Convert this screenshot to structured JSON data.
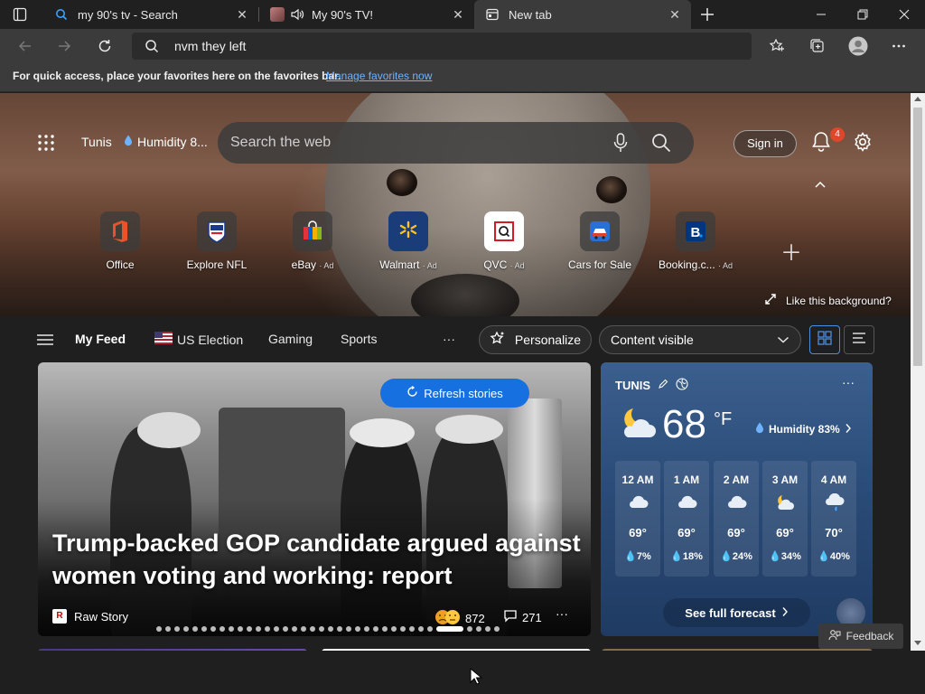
{
  "tabs": [
    {
      "title": "my 90's tv - Search",
      "icon": "search-icon"
    },
    {
      "title": "My 90's TV!",
      "icon": "audio-playing-icon"
    },
    {
      "title": "New tab",
      "icon": "new-tab-icon"
    }
  ],
  "address": {
    "value": "nvm they left"
  },
  "favorites_bar": {
    "message": "For quick access, place your favorites here on the favorites bar.",
    "link": "Manage favorites now"
  },
  "hero": {
    "location": "Tunis",
    "humidity": "Humidity 8...",
    "search_placeholder": "Search the web",
    "sign_in": "Sign in",
    "notifications": "4",
    "like_background": "Like this background?"
  },
  "quick_links": [
    {
      "label": "Office",
      "ad": ""
    },
    {
      "label": "Explore NFL",
      "ad": ""
    },
    {
      "label": "eBay",
      "ad": "· Ad"
    },
    {
      "label": "Walmart",
      "ad": "· Ad"
    },
    {
      "label": "QVC",
      "ad": "· Ad"
    },
    {
      "label": "Cars for Sale",
      "ad": ""
    },
    {
      "label": "Booking.c...",
      "ad": "· Ad"
    }
  ],
  "feed_nav": {
    "my_feed": "My Feed",
    "us_election": "US Election",
    "gaming": "Gaming",
    "sports": "Sports",
    "more": "···",
    "personalize": "Personalize",
    "content_visible": "Content visible"
  },
  "story": {
    "refresh": "Refresh stories",
    "headline": "Trump-backed GOP candidate argued against women voting and working: report",
    "source": "Raw Story",
    "source_logo": "R",
    "reactions": "872",
    "comments": "271",
    "more": "···"
  },
  "weather": {
    "city": "TUNIS",
    "more": "···",
    "temp": "68",
    "unit": "°F",
    "humidity": "Humidity 83%",
    "hours": [
      {
        "time": "12 AM",
        "temp": "69°",
        "precip": "7%",
        "icon": "cloud-icon"
      },
      {
        "time": "1 AM",
        "temp": "69°",
        "precip": "18%",
        "icon": "cloud-icon"
      },
      {
        "time": "2 AM",
        "temp": "69°",
        "precip": "24%",
        "icon": "cloud-icon"
      },
      {
        "time": "3 AM",
        "temp": "69°",
        "precip": "34%",
        "icon": "partly-cloudy-icon"
      },
      {
        "time": "4 AM",
        "temp": "70°",
        "precip": "40%",
        "icon": "rain-cloud-icon"
      }
    ],
    "forecast_button": "See full forecast"
  },
  "feedback": "Feedback",
  "colors": {
    "accent": "#1670e0",
    "badge": "#e0462a",
    "link": "#6fb3ff"
  }
}
